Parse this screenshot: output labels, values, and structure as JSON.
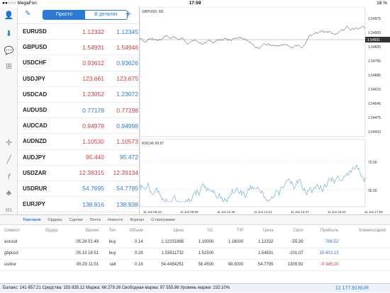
{
  "status": {
    "carrier": "●●○○○ MegaFon",
    "time": "17:59",
    "battery": "18 %"
  },
  "rail": {
    "icons": [
      "user-icon",
      "buy-icon",
      "chat-icon",
      "add-icon",
      "crosshair-icon",
      "line-icon",
      "fx-icon",
      "shapes-icon",
      "m1-icon"
    ],
    "m1": "M1"
  },
  "quotes": {
    "mode_simple": "Просто",
    "mode_detail": "В деталях",
    "rows": [
      {
        "sym": "EURUSD",
        "bid": "1.12332",
        "ask": "1.12345",
        "bc": "red",
        "ac": "blue"
      },
      {
        "sym": "GBPUSD",
        "bid": "1.54931",
        "ask": "1.54946",
        "bc": "red",
        "ac": "red"
      },
      {
        "sym": "USDCHF",
        "bid": "0.93612",
        "ask": "0.93626",
        "bc": "red",
        "ac": "blue"
      },
      {
        "sym": "USDJPY",
        "bid": "123.661",
        "ask": "123.675",
        "bc": "red",
        "ac": "red"
      },
      {
        "sym": "USDCAD",
        "bid": "1.23052",
        "ask": "1.23072",
        "bc": "red",
        "ac": "blue"
      },
      {
        "sym": "AUDUSD",
        "bid": "0.77178",
        "ask": "0.77198",
        "bc": "blue",
        "ac": "red"
      },
      {
        "sym": "AUDCAD",
        "bid": "0.94978",
        "ask": "0.94998",
        "bc": "red",
        "ac": "blue"
      },
      {
        "sym": "AUDNZD",
        "bid": "1.10530",
        "ask": "1.10573",
        "bc": "red",
        "ac": "red"
      },
      {
        "sym": "AUDJPY",
        "bid": "95.440",
        "ask": "95.472",
        "bc": "red",
        "ac": "blue"
      },
      {
        "sym": "USDZAR",
        "bid": "12.38315",
        "ask": "12.39134",
        "bc": "red",
        "ac": "red"
      },
      {
        "sym": "USDRUR",
        "bid": "54.7695",
        "ask": "54.7795",
        "bc": "blue",
        "ac": "blue"
      },
      {
        "sym": "EURJPY",
        "bid": "138.916",
        "ask": "138.938",
        "bc": "blue",
        "ac": "blue"
      }
    ]
  },
  "chart": {
    "title": "GBPUSD, M1",
    "current": "1.54931",
    "ytick": [
      "1.54975",
      "1.54900",
      "1.54825",
      "1.54755",
      "1.54685",
      "1.54615",
      "1.54545",
      "1.54475",
      "1.54410"
    ],
    "rsi_label": "RSI(14) 59.67",
    "rsi_ticks": [
      "70.00",
      "30.00"
    ],
    "xticks": [
      "11 Jun 08:23",
      "11 Jun 09:59",
      "11 Jun 11:35",
      "11 Jun 13:11",
      "11 Jun 14:47",
      "11 Jun 16:23",
      "11 Jun 17:59"
    ]
  },
  "tabs": [
    "Торговля",
    "Ордеры",
    "Сделки",
    "Почта",
    "Новости",
    "Журнал",
    "О программе"
  ],
  "table": {
    "headers": [
      "Символ",
      "Ордер",
      "Время",
      "Тип",
      "Объем",
      "Цена",
      "S/L",
      "T/P",
      "Цена",
      "Своп",
      "Прибыль",
      "Комментарий"
    ],
    "rows": [
      [
        "eurusd",
        "",
        "05.28 01:49",
        "buy",
        "0.14",
        "1.12231866",
        "1.10000",
        "1.18000",
        "1.12332",
        "-55.39",
        "766.52",
        ""
      ],
      [
        "gbpusd",
        "",
        "05.13 18:51",
        "buy",
        "0.28",
        "1.53911732",
        "1.51500",
        "",
        "1.54931",
        "-101.07",
        "15 603.13",
        ""
      ],
      [
        "usdrur",
        "",
        "05.29 11:01",
        "sell",
        "0.16",
        "54.4454251",
        "58.4500",
        "48.0000",
        "54.7795",
        "1309.92",
        "-5 345.20",
        ""
      ]
    ]
  },
  "footer": {
    "text": "Баланс: 141 657.21 Средства: 153 835.12 Маржа: 66 279.26 Свободная маржа: 87 555.86 Уровень маржи: 232.10%",
    "equity": "12 177.91",
    "currency": "RUR"
  }
}
